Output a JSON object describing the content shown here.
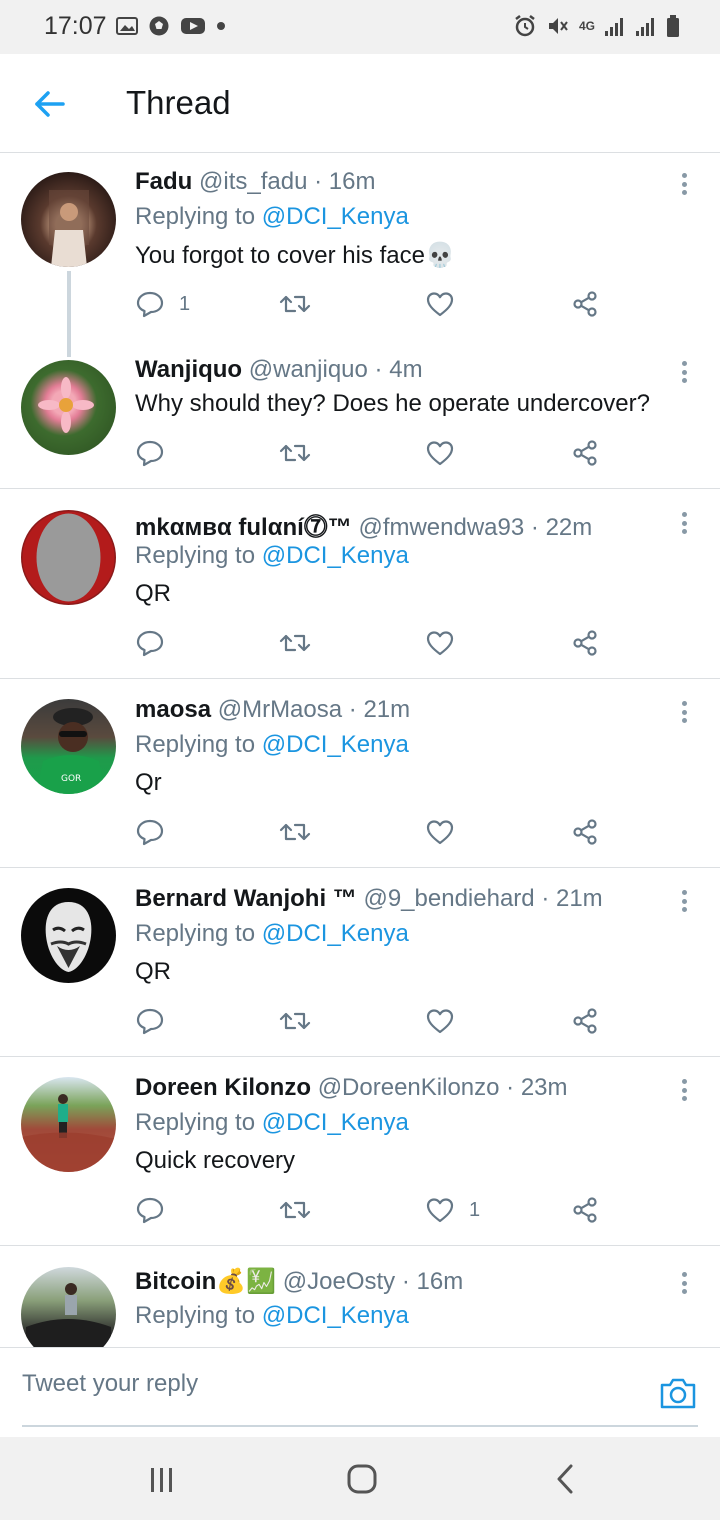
{
  "status_bar": {
    "time": "17:07",
    "network": "4G"
  },
  "header": {
    "title": "Thread",
    "back_icon": "arrow-left-icon"
  },
  "colors": {
    "accent": "#1b95e0",
    "secondary_text": "#657786",
    "divider": "#dcdfe2"
  },
  "tweets": [
    {
      "name": "Fadu",
      "handle": "@its_fadu",
      "sep": "·",
      "time": "16m",
      "replying_prefix": "Replying to",
      "replying_to": "@DCI_Kenya",
      "text": "You forgot to cover his face💀",
      "reply_count": "1",
      "like_count": ""
    },
    {
      "name": "Wanjiquo",
      "handle": "@wanjiquo",
      "sep": "·",
      "time": "4m",
      "replying_prefix": "",
      "replying_to": "",
      "text": "Why should they? Does he operate undercover?",
      "reply_count": "",
      "like_count": ""
    },
    {
      "name": "mkαмвα fulαní⓻™",
      "handle": "@fmwendwa93",
      "sep": "·",
      "time": "22m",
      "replying_prefix": "Replying to",
      "replying_to": "@DCI_Kenya",
      "text": "QR",
      "reply_count": "",
      "like_count": ""
    },
    {
      "name": "maosa",
      "handle": "@MrMaosa",
      "sep": "·",
      "time": "21m",
      "replying_prefix": "Replying to",
      "replying_to": "@DCI_Kenya",
      "text": "Qr",
      "reply_count": "",
      "like_count": ""
    },
    {
      "name": "Bernard Wanjohi ™",
      "handle": "@9_bendiehard",
      "sep": "·",
      "time": "21m",
      "replying_prefix": "Replying to",
      "replying_to": "@DCI_Kenya",
      "text": "QR",
      "reply_count": "",
      "like_count": ""
    },
    {
      "name": "Doreen Kilonzo",
      "handle": "@DoreenKilonzo",
      "sep": "·",
      "time": "23m",
      "replying_prefix": "Replying to",
      "replying_to": "@DCI_Kenya",
      "text": "Quick recovery",
      "reply_count": "",
      "like_count": "1"
    },
    {
      "name": "Bitcoin💰💹",
      "handle": "@JoeOsty",
      "sep": "·",
      "time": "16m",
      "replying_prefix": "Replying to",
      "replying_to": "@DCI_Kenya",
      "text": "",
      "reply_count": "",
      "like_count": ""
    }
  ],
  "composer": {
    "placeholder": "Tweet your reply",
    "camera_icon": "camera-icon"
  },
  "nav": {
    "recents_icon": "recents-icon",
    "home_icon": "home-icon",
    "back_icon": "back-chevron-icon"
  }
}
